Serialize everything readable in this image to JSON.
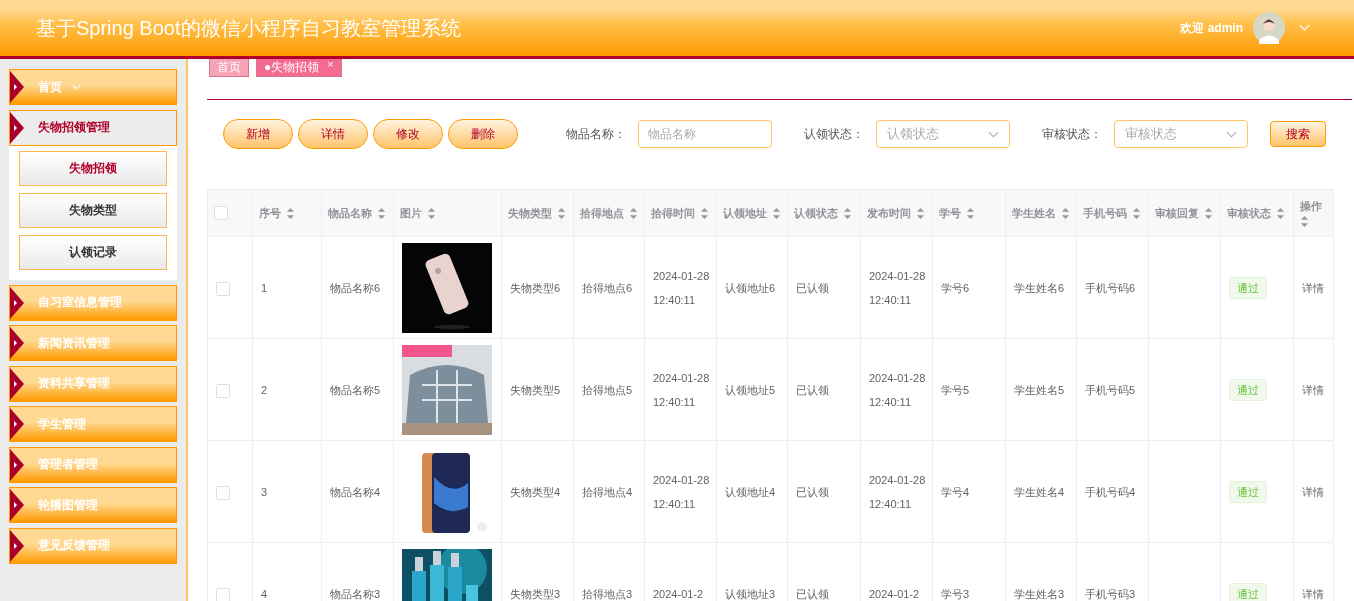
{
  "header": {
    "title": "基于Spring Boot的微信小程序自习教室管理系统",
    "welcome": "欢迎 admin"
  },
  "sidebar": {
    "items": [
      {
        "label": "首页",
        "expanded": false,
        "chevron": true
      },
      {
        "label": "失物招领管理",
        "expanded": true,
        "children": [
          {
            "label": "失物招领",
            "selected": true
          },
          {
            "label": "失物类型",
            "selected": false
          },
          {
            "label": "认领记录",
            "selected": false
          }
        ]
      },
      {
        "label": "自习室信息管理",
        "expanded": false
      },
      {
        "label": "新闻资讯管理",
        "expanded": false
      },
      {
        "label": "资料共享管理",
        "expanded": false
      },
      {
        "label": "学生管理",
        "expanded": false
      },
      {
        "label": "管理者管理",
        "expanded": false
      },
      {
        "label": "轮播图管理",
        "expanded": false
      },
      {
        "label": "意见反馈管理",
        "expanded": false
      }
    ]
  },
  "tabs": [
    {
      "label": "首页",
      "selected": false
    },
    {
      "label": "●失物招领",
      "selected": true,
      "close": "×"
    }
  ],
  "toolbar": {
    "buttons": [
      "新增",
      "详情",
      "修改",
      "删除"
    ],
    "filters": [
      {
        "kind": "input",
        "label": "物品名称：",
        "placeholder": "物品名称"
      },
      {
        "kind": "select",
        "label": "认领状态：",
        "placeholder": "认领状态"
      },
      {
        "kind": "select",
        "label": "审核状态：",
        "placeholder": "审核状态"
      }
    ],
    "search": "搜索"
  },
  "table": {
    "header_checked": false,
    "columns": [
      {
        "label": "序号",
        "sortable": true
      },
      {
        "label": "物品名称",
        "sortable": true
      },
      {
        "label": "图片",
        "sortable": true
      },
      {
        "label": "失物类型",
        "sortable": true
      },
      {
        "label": "拾得地点",
        "sortable": true
      },
      {
        "label": "拾得时间",
        "sortable": true
      },
      {
        "label": "认领地址",
        "sortable": true
      },
      {
        "label": "认领状态",
        "sortable": true
      },
      {
        "label": "发布时间",
        "sortable": true
      },
      {
        "label": "学号",
        "sortable": true
      },
      {
        "label": "学生姓名",
        "sortable": true
      },
      {
        "label": "手机号码",
        "sortable": true
      },
      {
        "label": "审核回复",
        "sortable": true
      },
      {
        "label": "审核状态",
        "sortable": true
      },
      {
        "label": "操作",
        "sortable": true
      }
    ],
    "rows": [
      {
        "checked": false,
        "cells": [
          "1",
          "物品名称6",
          "",
          "失物类型6",
          "拾得地点6",
          "2024-01-28 12:40:11",
          "认领地址6",
          "已认领",
          "2024-01-28 12:40:11",
          "学号6",
          "学生姓名6",
          "手机号码6",
          "",
          "通过",
          "详情"
        ]
      },
      {
        "checked": false,
        "cells": [
          "2",
          "物品名称5",
          "",
          "失物类型5",
          "拾得地点5",
          "2024-01-28 12:40:11",
          "认领地址5",
          "已认领",
          "2024-01-28 12:40:11",
          "学号5",
          "学生姓名5",
          "手机号码5",
          "",
          "通过",
          "详情"
        ]
      },
      {
        "checked": false,
        "cells": [
          "3",
          "物品名称4",
          "",
          "失物类型4",
          "拾得地点4",
          "2024-01-28 12:40:11",
          "认领地址4",
          "已认领",
          "2024-01-28 12:40:11",
          "学号4",
          "学生姓名4",
          "手机号码4",
          "",
          "通过",
          "详情"
        ]
      },
      {
        "checked": false,
        "cells": [
          "4",
          "物品名称3",
          "",
          "失物类型3",
          "拾得地点3",
          "2024-01-2",
          "认领地址3",
          "已认领",
          "2024-01-2",
          "学号3",
          "学生姓名3",
          "手机号码3",
          "",
          "通过",
          "详情"
        ]
      }
    ]
  }
}
